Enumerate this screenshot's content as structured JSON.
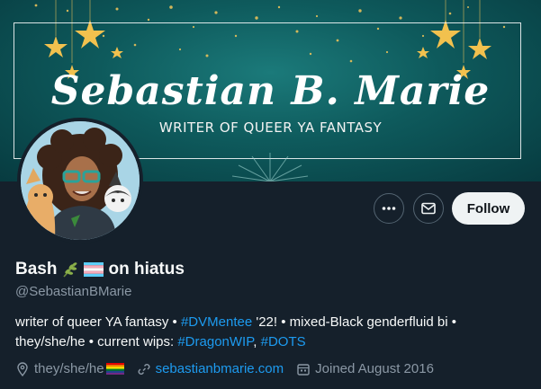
{
  "banner": {
    "name": "Sebastian B. Marie",
    "tagline": "WRITER OF QUEER YA FANTASY"
  },
  "actions": {
    "more_icon": "more-horizontal-icon",
    "message_icon": "envelope-icon",
    "follow_label": "Follow"
  },
  "profile": {
    "display_name_part1": "Bash",
    "display_name_part2": "on hiatus",
    "name_emojis": [
      "herb",
      "transgender-flag"
    ],
    "handle": "@SebastianBMarie"
  },
  "bio": {
    "t1": "writer of queer YA fantasy • ",
    "tag1": "#DVMentee",
    "t2": " '22! • mixed-Black genderfluid bi •",
    "t3": "they/she/he • current wips: ",
    "tag2": "#DragonWIP",
    "t4": ", ",
    "tag3": "#DOTS"
  },
  "meta": {
    "pronouns": "they/she/he",
    "website": "sebastianbmarie.com",
    "joined": "Joined August 2016"
  },
  "colors": {
    "background": "#15202b",
    "link": "#1d9bf0",
    "muted": "#8b98a5",
    "text": "#f7f9f9",
    "banner_teal": "#0e5a5c"
  }
}
